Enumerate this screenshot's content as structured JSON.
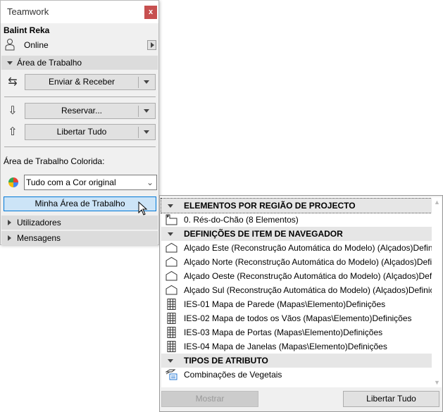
{
  "panel": {
    "title": "Teamwork",
    "close_label": "x",
    "user": "Balint Reka",
    "status": "Online",
    "workspace_section": "Área de Trabalho",
    "send_receive": "Enviar & Receber",
    "reserve": "Reservar...",
    "release_all": "Libertar Tudo",
    "colored_label": "Área de Trabalho Colorida:",
    "color_select_value": "Tudo com a Cor original",
    "my_workspace": "Minha Área de Trabalho",
    "users_section": "Utilizadores",
    "messages_section": "Mensagens"
  },
  "popup": {
    "groups": [
      {
        "header": "ELEMENTOS POR REGIÃO DE PROJECTO",
        "items": [
          {
            "icon": "story-icon",
            "label": "0. Rés-do-Chão (8 Elementos)"
          }
        ]
      },
      {
        "header": "DEFINIÇÕES DE ITEM DE NAVEGADOR",
        "items": [
          {
            "icon": "elevation-icon",
            "label": "Alçado Este (Reconstrução Automática do Modelo) (Alçados)Defini..."
          },
          {
            "icon": "elevation-icon",
            "label": "Alçado Norte (Reconstrução Automática do Modelo) (Alçados)Defi..."
          },
          {
            "icon": "elevation-icon",
            "label": "Alçado Oeste (Reconstrução Automática do Modelo) (Alçados)Defi..."
          },
          {
            "icon": "elevation-icon",
            "label": "Alçado Sul (Reconstrução Automática do Modelo) (Alçados)Definiç..."
          },
          {
            "icon": "schedule-icon",
            "label": "IES-01 Mapa de Parede (Mapas\\Elemento)Definições"
          },
          {
            "icon": "schedule-icon",
            "label": "IES-02 Mapa de todos os Vãos (Mapas\\Elemento)Definições"
          },
          {
            "icon": "schedule-icon",
            "label": "IES-03 Mapa de Portas (Mapas\\Elemento)Definições"
          },
          {
            "icon": "schedule-icon",
            "label": "IES-04 Mapa de Janelas (Mapas\\Elemento)Definições"
          }
        ]
      },
      {
        "header": "TIPOS DE ATRIBUTO",
        "items": [
          {
            "icon": "attribute-combination-icon",
            "label": "Combinações de Vegetais"
          }
        ]
      }
    ],
    "show_button": "Mostrar",
    "release_all_button": "Libertar Tudo"
  }
}
